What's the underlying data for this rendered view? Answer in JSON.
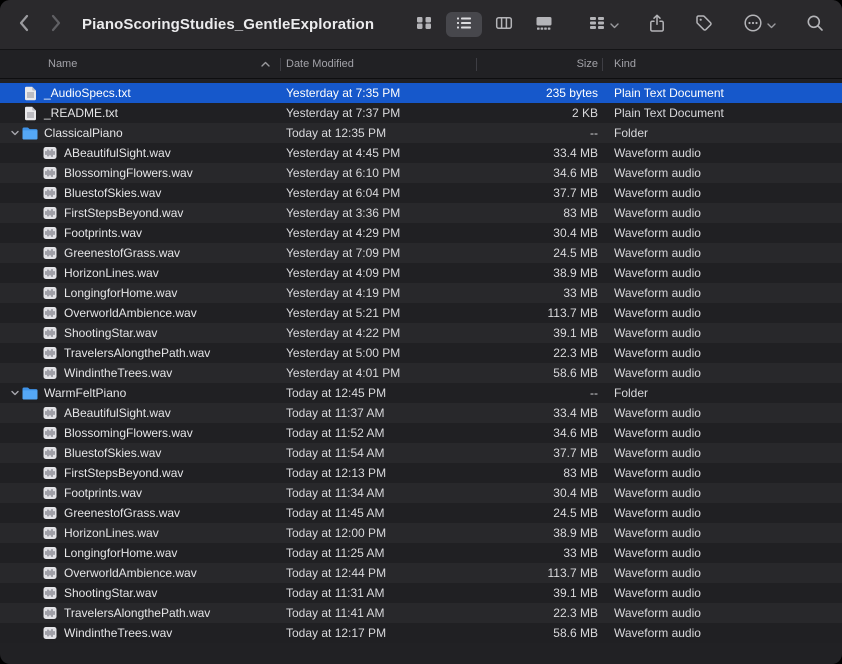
{
  "toolbar": {
    "title": "PianoScoringStudies_GentleExploration",
    "buttons": [
      {
        "name": "back-button",
        "icon": "chevron-left"
      },
      {
        "name": "forward-button",
        "icon": "chevron-right"
      },
      {
        "name": "icon-view-button",
        "icon": "grid-icon"
      },
      {
        "name": "list-view-button",
        "icon": "list-icon",
        "selected": true
      },
      {
        "name": "column-view-button",
        "icon": "columns-icon"
      },
      {
        "name": "gallery-view-button",
        "icon": "gallery-icon"
      },
      {
        "name": "group-button",
        "icon": "group-icon"
      },
      {
        "name": "share-button",
        "icon": "share-icon"
      },
      {
        "name": "tag-button",
        "icon": "tag-icon"
      },
      {
        "name": "more-button",
        "icon": "ellipsis-circle-icon"
      },
      {
        "name": "search-button",
        "icon": "search-icon"
      }
    ]
  },
  "columns": [
    {
      "label": "Name",
      "sort": "asc"
    },
    {
      "label": "Date Modified"
    },
    {
      "label": "Size"
    },
    {
      "label": "Kind"
    }
  ],
  "colors": {
    "selection": "#1658cb",
    "folder": "#4aa1f3",
    "toolbar_bg": "#2a292c",
    "row_light": "#28282b",
    "row_dark": "#202023"
  },
  "rows": [
    {
      "name": "_AudioSpecs.txt",
      "date": "Yesterday at 7:35 PM",
      "size": "235 bytes",
      "kind": "Plain Text Document",
      "icon": "text",
      "level": 0,
      "selected": true
    },
    {
      "name": "_README.txt",
      "date": "Yesterday at 7:37 PM",
      "size": "2 KB",
      "kind": "Plain Text Document",
      "icon": "text",
      "level": 0
    },
    {
      "name": "ClassicalPiano",
      "date": "Today at 12:35 PM",
      "size": "--",
      "kind": "Folder",
      "icon": "folder",
      "level": 0,
      "expanded": true
    },
    {
      "name": "ABeautifulSight.wav",
      "date": "Yesterday at 4:45 PM",
      "size": "33.4 MB",
      "kind": "Waveform audio",
      "icon": "wav",
      "level": 1
    },
    {
      "name": "BlossomingFlowers.wav",
      "date": "Yesterday at 6:10 PM",
      "size": "34.6 MB",
      "kind": "Waveform audio",
      "icon": "wav",
      "level": 1
    },
    {
      "name": "BluestofSkies.wav",
      "date": "Yesterday at 6:04 PM",
      "size": "37.7 MB",
      "kind": "Waveform audio",
      "icon": "wav",
      "level": 1
    },
    {
      "name": "FirstStepsBeyond.wav",
      "date": "Yesterday at 3:36 PM",
      "size": "83 MB",
      "kind": "Waveform audio",
      "icon": "wav",
      "level": 1
    },
    {
      "name": "Footprints.wav",
      "date": "Yesterday at 4:29 PM",
      "size": "30.4 MB",
      "kind": "Waveform audio",
      "icon": "wav",
      "level": 1
    },
    {
      "name": "GreenestofGrass.wav",
      "date": "Yesterday at 7:09 PM",
      "size": "24.5 MB",
      "kind": "Waveform audio",
      "icon": "wav",
      "level": 1
    },
    {
      "name": "HorizonLines.wav",
      "date": "Yesterday at 4:09 PM",
      "size": "38.9 MB",
      "kind": "Waveform audio",
      "icon": "wav",
      "level": 1
    },
    {
      "name": "LongingforHome.wav",
      "date": "Yesterday at 4:19 PM",
      "size": "33 MB",
      "kind": "Waveform audio",
      "icon": "wav",
      "level": 1
    },
    {
      "name": "OverworldAmbience.wav",
      "date": "Yesterday at 5:21 PM",
      "size": "113.7 MB",
      "kind": "Waveform audio",
      "icon": "wav",
      "level": 1
    },
    {
      "name": "ShootingStar.wav",
      "date": "Yesterday at 4:22 PM",
      "size": "39.1 MB",
      "kind": "Waveform audio",
      "icon": "wav",
      "level": 1
    },
    {
      "name": "TravelersAlongthePath.wav",
      "date": "Yesterday at 5:00 PM",
      "size": "22.3 MB",
      "kind": "Waveform audio",
      "icon": "wav",
      "level": 1
    },
    {
      "name": "WindintheTrees.wav",
      "date": "Yesterday at 4:01 PM",
      "size": "58.6 MB",
      "kind": "Waveform audio",
      "icon": "wav",
      "level": 1
    },
    {
      "name": "WarmFeltPiano",
      "date": "Today at 12:45 PM",
      "size": "--",
      "kind": "Folder",
      "icon": "folder",
      "level": 0,
      "expanded": true
    },
    {
      "name": "ABeautifulSight.wav",
      "date": "Today at 11:37 AM",
      "size": "33.4 MB",
      "kind": "Waveform audio",
      "icon": "wav",
      "level": 1
    },
    {
      "name": "BlossomingFlowers.wav",
      "date": "Today at 11:52 AM",
      "size": "34.6 MB",
      "kind": "Waveform audio",
      "icon": "wav",
      "level": 1
    },
    {
      "name": "BluestofSkies.wav",
      "date": "Today at 11:54 AM",
      "size": "37.7 MB",
      "kind": "Waveform audio",
      "icon": "wav",
      "level": 1
    },
    {
      "name": "FirstStepsBeyond.wav",
      "date": "Today at 12:13 PM",
      "size": "83 MB",
      "kind": "Waveform audio",
      "icon": "wav",
      "level": 1
    },
    {
      "name": "Footprints.wav",
      "date": "Today at 11:34 AM",
      "size": "30.4 MB",
      "kind": "Waveform audio",
      "icon": "wav",
      "level": 1
    },
    {
      "name": "GreenestofGrass.wav",
      "date": "Today at 11:45 AM",
      "size": "24.5 MB",
      "kind": "Waveform audio",
      "icon": "wav",
      "level": 1
    },
    {
      "name": "HorizonLines.wav",
      "date": "Today at 12:00 PM",
      "size": "38.9 MB",
      "kind": "Waveform audio",
      "icon": "wav",
      "level": 1
    },
    {
      "name": "LongingforHome.wav",
      "date": "Today at 11:25 AM",
      "size": "33 MB",
      "kind": "Waveform audio",
      "icon": "wav",
      "level": 1
    },
    {
      "name": "OverworldAmbience.wav",
      "date": "Today at 12:44 PM",
      "size": "113.7 MB",
      "kind": "Waveform audio",
      "icon": "wav",
      "level": 1
    },
    {
      "name": "ShootingStar.wav",
      "date": "Today at 11:31 AM",
      "size": "39.1 MB",
      "kind": "Waveform audio",
      "icon": "wav",
      "level": 1
    },
    {
      "name": "TravelersAlongthePath.wav",
      "date": "Today at 11:41 AM",
      "size": "22.3 MB",
      "kind": "Waveform audio",
      "icon": "wav",
      "level": 1
    },
    {
      "name": "WindintheTrees.wav",
      "date": "Today at 12:17 PM",
      "size": "58.6 MB",
      "kind": "Waveform audio",
      "icon": "wav",
      "level": 1
    }
  ]
}
